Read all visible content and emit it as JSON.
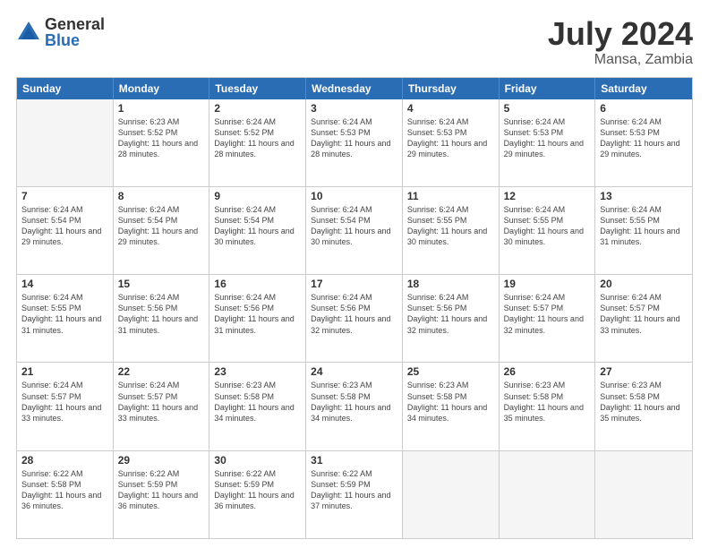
{
  "header": {
    "logo_general": "General",
    "logo_blue": "Blue",
    "month": "July 2024",
    "location": "Mansa, Zambia"
  },
  "weekdays": [
    "Sunday",
    "Monday",
    "Tuesday",
    "Wednesday",
    "Thursday",
    "Friday",
    "Saturday"
  ],
  "rows": [
    [
      {
        "day": "",
        "empty": true
      },
      {
        "day": "1",
        "sunrise": "Sunrise: 6:23 AM",
        "sunset": "Sunset: 5:52 PM",
        "daylight": "Daylight: 11 hours and 28 minutes."
      },
      {
        "day": "2",
        "sunrise": "Sunrise: 6:24 AM",
        "sunset": "Sunset: 5:52 PM",
        "daylight": "Daylight: 11 hours and 28 minutes."
      },
      {
        "day": "3",
        "sunrise": "Sunrise: 6:24 AM",
        "sunset": "Sunset: 5:53 PM",
        "daylight": "Daylight: 11 hours and 28 minutes."
      },
      {
        "day": "4",
        "sunrise": "Sunrise: 6:24 AM",
        "sunset": "Sunset: 5:53 PM",
        "daylight": "Daylight: 11 hours and 29 minutes."
      },
      {
        "day": "5",
        "sunrise": "Sunrise: 6:24 AM",
        "sunset": "Sunset: 5:53 PM",
        "daylight": "Daylight: 11 hours and 29 minutes."
      },
      {
        "day": "6",
        "sunrise": "Sunrise: 6:24 AM",
        "sunset": "Sunset: 5:53 PM",
        "daylight": "Daylight: 11 hours and 29 minutes."
      }
    ],
    [
      {
        "day": "7",
        "sunrise": "Sunrise: 6:24 AM",
        "sunset": "Sunset: 5:54 PM",
        "daylight": "Daylight: 11 hours and 29 minutes."
      },
      {
        "day": "8",
        "sunrise": "Sunrise: 6:24 AM",
        "sunset": "Sunset: 5:54 PM",
        "daylight": "Daylight: 11 hours and 29 minutes."
      },
      {
        "day": "9",
        "sunrise": "Sunrise: 6:24 AM",
        "sunset": "Sunset: 5:54 PM",
        "daylight": "Daylight: 11 hours and 30 minutes."
      },
      {
        "day": "10",
        "sunrise": "Sunrise: 6:24 AM",
        "sunset": "Sunset: 5:54 PM",
        "daylight": "Daylight: 11 hours and 30 minutes."
      },
      {
        "day": "11",
        "sunrise": "Sunrise: 6:24 AM",
        "sunset": "Sunset: 5:55 PM",
        "daylight": "Daylight: 11 hours and 30 minutes."
      },
      {
        "day": "12",
        "sunrise": "Sunrise: 6:24 AM",
        "sunset": "Sunset: 5:55 PM",
        "daylight": "Daylight: 11 hours and 30 minutes."
      },
      {
        "day": "13",
        "sunrise": "Sunrise: 6:24 AM",
        "sunset": "Sunset: 5:55 PM",
        "daylight": "Daylight: 11 hours and 31 minutes."
      }
    ],
    [
      {
        "day": "14",
        "sunrise": "Sunrise: 6:24 AM",
        "sunset": "Sunset: 5:55 PM",
        "daylight": "Daylight: 11 hours and 31 minutes."
      },
      {
        "day": "15",
        "sunrise": "Sunrise: 6:24 AM",
        "sunset": "Sunset: 5:56 PM",
        "daylight": "Daylight: 11 hours and 31 minutes."
      },
      {
        "day": "16",
        "sunrise": "Sunrise: 6:24 AM",
        "sunset": "Sunset: 5:56 PM",
        "daylight": "Daylight: 11 hours and 31 minutes."
      },
      {
        "day": "17",
        "sunrise": "Sunrise: 6:24 AM",
        "sunset": "Sunset: 5:56 PM",
        "daylight": "Daylight: 11 hours and 32 minutes."
      },
      {
        "day": "18",
        "sunrise": "Sunrise: 6:24 AM",
        "sunset": "Sunset: 5:56 PM",
        "daylight": "Daylight: 11 hours and 32 minutes."
      },
      {
        "day": "19",
        "sunrise": "Sunrise: 6:24 AM",
        "sunset": "Sunset: 5:57 PM",
        "daylight": "Daylight: 11 hours and 32 minutes."
      },
      {
        "day": "20",
        "sunrise": "Sunrise: 6:24 AM",
        "sunset": "Sunset: 5:57 PM",
        "daylight": "Daylight: 11 hours and 33 minutes."
      }
    ],
    [
      {
        "day": "21",
        "sunrise": "Sunrise: 6:24 AM",
        "sunset": "Sunset: 5:57 PM",
        "daylight": "Daylight: 11 hours and 33 minutes."
      },
      {
        "day": "22",
        "sunrise": "Sunrise: 6:24 AM",
        "sunset": "Sunset: 5:57 PM",
        "daylight": "Daylight: 11 hours and 33 minutes."
      },
      {
        "day": "23",
        "sunrise": "Sunrise: 6:23 AM",
        "sunset": "Sunset: 5:58 PM",
        "daylight": "Daylight: 11 hours and 34 minutes."
      },
      {
        "day": "24",
        "sunrise": "Sunrise: 6:23 AM",
        "sunset": "Sunset: 5:58 PM",
        "daylight": "Daylight: 11 hours and 34 minutes."
      },
      {
        "day": "25",
        "sunrise": "Sunrise: 6:23 AM",
        "sunset": "Sunset: 5:58 PM",
        "daylight": "Daylight: 11 hours and 34 minutes."
      },
      {
        "day": "26",
        "sunrise": "Sunrise: 6:23 AM",
        "sunset": "Sunset: 5:58 PM",
        "daylight": "Daylight: 11 hours and 35 minutes."
      },
      {
        "day": "27",
        "sunrise": "Sunrise: 6:23 AM",
        "sunset": "Sunset: 5:58 PM",
        "daylight": "Daylight: 11 hours and 35 minutes."
      }
    ],
    [
      {
        "day": "28",
        "sunrise": "Sunrise: 6:22 AM",
        "sunset": "Sunset: 5:58 PM",
        "daylight": "Daylight: 11 hours and 36 minutes."
      },
      {
        "day": "29",
        "sunrise": "Sunrise: 6:22 AM",
        "sunset": "Sunset: 5:59 PM",
        "daylight": "Daylight: 11 hours and 36 minutes."
      },
      {
        "day": "30",
        "sunrise": "Sunrise: 6:22 AM",
        "sunset": "Sunset: 5:59 PM",
        "daylight": "Daylight: 11 hours and 36 minutes."
      },
      {
        "day": "31",
        "sunrise": "Sunrise: 6:22 AM",
        "sunset": "Sunset: 5:59 PM",
        "daylight": "Daylight: 11 hours and 37 minutes."
      },
      {
        "day": "",
        "empty": true
      },
      {
        "day": "",
        "empty": true
      },
      {
        "day": "",
        "empty": true
      }
    ]
  ]
}
